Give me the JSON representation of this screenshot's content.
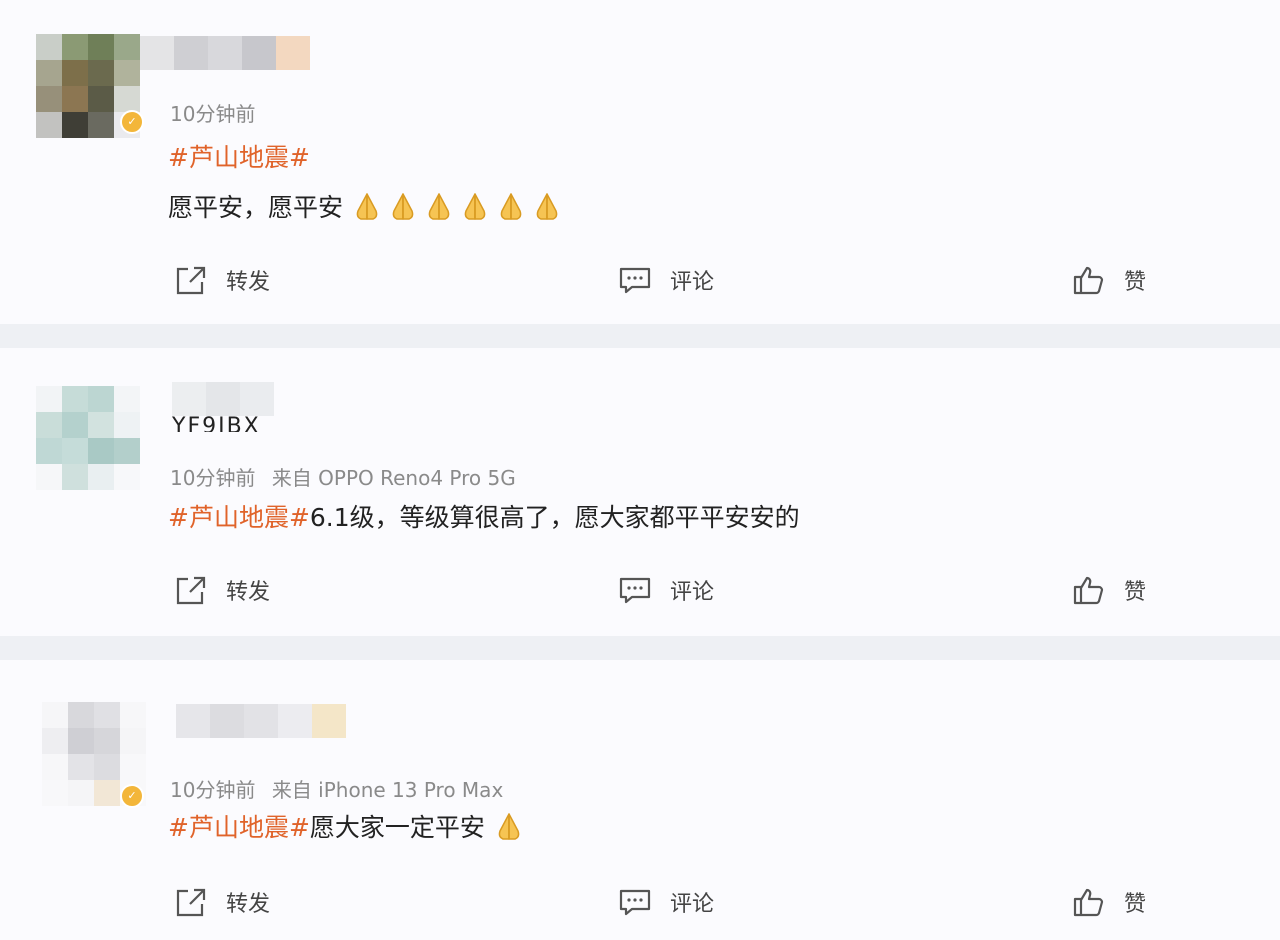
{
  "posts": [
    {
      "time": "10分钟前",
      "source": "",
      "hashtag": "#芦山地震#",
      "text": "愿平安，愿平安",
      "emoji_count": 6,
      "verified": true,
      "actions": {
        "repost": "转发",
        "comment": "评论",
        "like": "赞"
      }
    },
    {
      "username_partial": "YF9JBX",
      "time": "10分钟前",
      "source": "来自 OPPO Reno4 Pro 5G",
      "hashtag": "#芦山地震#",
      "text": "6.1级，等级算很高了，愿大家都平平安安的",
      "emoji_count": 0,
      "verified": false,
      "actions": {
        "repost": "转发",
        "comment": "评论",
        "like": "赞"
      }
    },
    {
      "time": "10分钟前",
      "source": "来自 iPhone 13 Pro Max",
      "hashtag": "#芦山地震#",
      "text": "愿大家一定平安",
      "emoji_count": 1,
      "verified": true,
      "actions": {
        "repost": "转发",
        "comment": "评论",
        "like": "赞"
      }
    }
  ],
  "icons": {
    "repost": "repost-icon",
    "comment": "comment-icon",
    "like": "thumbs-up-icon",
    "emoji": "folded-hands-emoji",
    "verified": "verified-badge-icon"
  },
  "colors": {
    "hashtag": "#e0632a",
    "meta": "#8a8a8a",
    "badge": "#f3b63a"
  }
}
